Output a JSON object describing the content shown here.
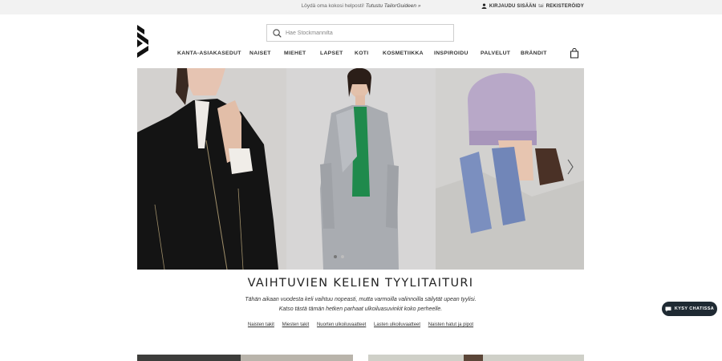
{
  "topbar": {
    "promo_text": "Löydä oma kokosi helposti!",
    "promo_link": "Tutustu TailorGuideen »",
    "login_label": "KIRJAUDU SISÄÄN",
    "login_sep": "tai",
    "register_label": "REKISTERÖIDY"
  },
  "search": {
    "placeholder": "Hae Stockmannilta"
  },
  "nav": {
    "items": [
      "KANTA-ASIAKASEDUT",
      "NAISET",
      "MIEHET",
      "LAPSET",
      "KOTI",
      "KOSMETIIKKA",
      "INSPIROIDU",
      "PALVELUT",
      "BRÄNDIT"
    ]
  },
  "hero": {
    "slide_count": 2,
    "active_slide": 1
  },
  "campaign": {
    "headline": "VAIHTUVIEN KELIEN TYYLITAITURI",
    "line1": "Tähän aikaan vuodesta keli vaihtuu nopeasti, mutta varmoilla valinnoilla säilytät upean tyylisi.",
    "line2": "Katso tästä tämän hetken parhaat ulkoiluasuvinkit koko perheelle.",
    "links": [
      "Naisten takit",
      "Miesten takit",
      "Nuorten ulkoiluvaatteet",
      "Lasten ulkoiluvaatteet",
      "Naisten hatut ja pipot"
    ]
  },
  "chat": {
    "label": "KYSY CHATISSA"
  },
  "colors": {
    "chat_bg": "#1f2a33",
    "topbar_bg": "#f2f2f2"
  },
  "icons": [
    "user-icon",
    "search-icon",
    "cart-icon",
    "chevron-right-icon",
    "chat-bubble-icon",
    "stockmann-logo"
  ]
}
